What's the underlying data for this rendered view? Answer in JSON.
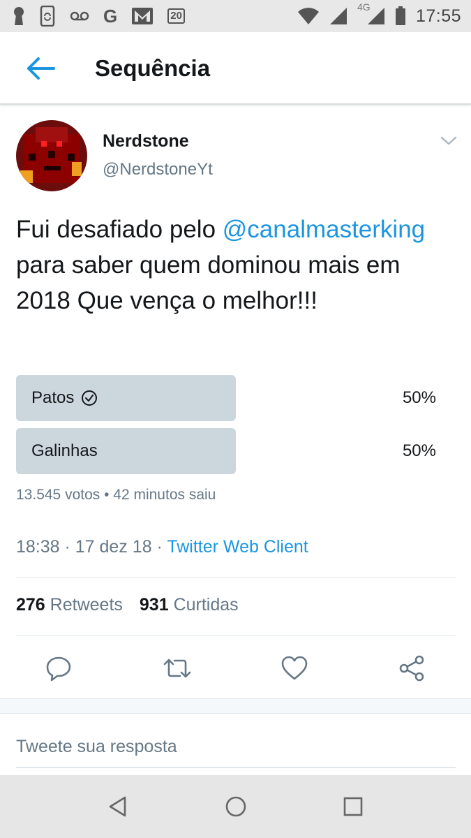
{
  "status_bar": {
    "time": "17:55",
    "network": "4G",
    "notification_badge": "20",
    "google_letter": "G",
    "icons": [
      "keyhole-icon",
      "phone-sync-icon",
      "voicemail-icon",
      "google-icon",
      "gmail-icon",
      "badge-icon",
      "wifi-icon",
      "signal-icon",
      "battery-icon"
    ]
  },
  "header": {
    "title": "Sequência",
    "back_icon": "arrow-left-icon"
  },
  "tweet": {
    "author_name": "Nerdstone",
    "author_handle": "@NerdstoneYt",
    "text_before_mention": "Fui desafiado pelo ",
    "mention": "@canalmasterking",
    "text_after_mention": " para saber quem dominou mais em 2018 Que vença o melhor!!!",
    "poll": {
      "options": [
        {
          "label": "Patos",
          "percent_text": "50%",
          "fraction": 0.5,
          "winner": true
        },
        {
          "label": "Galinhas",
          "percent_text": "50%",
          "fraction": 0.5,
          "winner": false
        }
      ],
      "meta": "13.545 votos • 42 minutos saiu"
    },
    "timestamp": "18:38 · 17 dez 18 · ",
    "client": "Twitter Web Client",
    "stats": {
      "retweets_count": "276",
      "retweets_label": "Retweets",
      "likes_count": "931",
      "likes_label": "Curtidas"
    },
    "actions": [
      "reply-icon",
      "retweet-icon",
      "like-icon",
      "share-icon"
    ]
  },
  "reply": {
    "placeholder": "Tweete sua resposta"
  },
  "colors": {
    "accent": "#1b95e0",
    "text": "#14171a",
    "secondary": "#657786",
    "poll_bar": "#ccd6dd",
    "divider": "#e1e8ed"
  },
  "nav_bar": {
    "buttons": [
      "back-triangle-icon",
      "home-circle-icon",
      "recents-square-icon"
    ]
  }
}
